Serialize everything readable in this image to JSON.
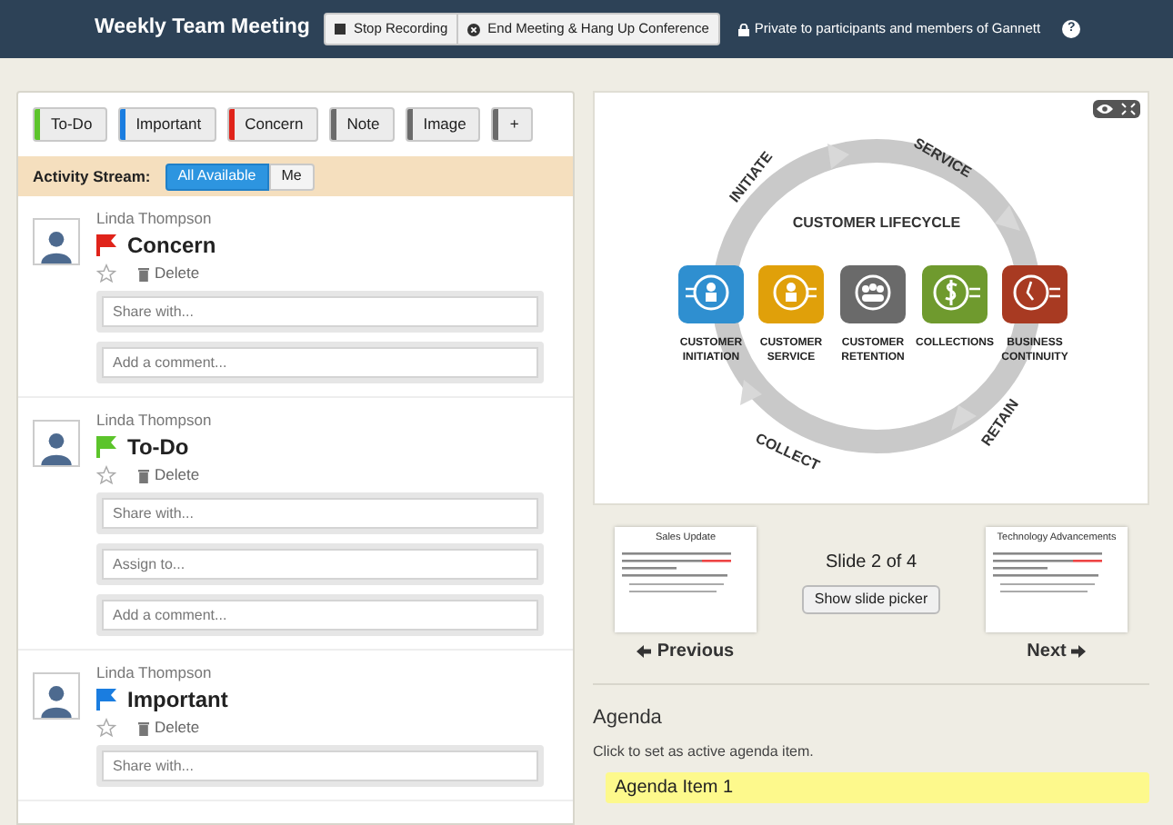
{
  "header": {
    "title": "Weekly Team Meeting",
    "buttons": [
      {
        "label": "Stop Recording",
        "kind": "stop"
      },
      {
        "label": "End Meeting & Hang Up Conference",
        "kind": "end"
      }
    ],
    "privacy": "Private to participants and members of Gannett",
    "help": "?"
  },
  "tags": [
    {
      "label": "To-Do",
      "color": "#5cc42b"
    },
    {
      "label": "Important",
      "color": "#1a7de0"
    },
    {
      "label": "Concern",
      "color": "#e0231a"
    },
    {
      "label": "Note",
      "color": "#6b6b6b"
    },
    {
      "label": "Image",
      "color": "#6b6b6b"
    },
    {
      "label": "+",
      "color": "#6b6b6b"
    }
  ],
  "activity_stream": {
    "label": "Activity Stream:",
    "filters": [
      {
        "label": "All Available",
        "selected": true
      },
      {
        "label": "Me",
        "selected": false
      }
    ]
  },
  "entries": [
    {
      "author": "Linda Thompson",
      "title": "Concern",
      "color": "#e0231a",
      "delete": "Delete",
      "fields": [
        {
          "placeholder": "Share with..."
        },
        {
          "placeholder": "Add a comment..."
        }
      ]
    },
    {
      "author": "Linda Thompson",
      "title": "To-Do",
      "color": "#5cc42b",
      "delete": "Delete",
      "fields": [
        {
          "placeholder": "Share with..."
        },
        {
          "placeholder": "Assign to..."
        },
        {
          "placeholder": "Add a comment..."
        }
      ]
    },
    {
      "author": "Linda Thompson",
      "title": "Important",
      "color": "#1a7de0",
      "delete": "Delete",
      "fields": [
        {
          "placeholder": "Share with..."
        }
      ]
    }
  ],
  "slide": {
    "title": "CUSTOMER LIFECYCLE",
    "ring_labels": [
      "INITIATE",
      "SERVICE",
      "RETAIN",
      "COLLECT"
    ],
    "stages": [
      {
        "lines": [
          "CUSTOMER",
          "INITIATION"
        ],
        "color": "#2f8fd0",
        "kind": "person-in"
      },
      {
        "lines": [
          "CUSTOMER",
          "SERVICE"
        ],
        "color": "#e0a00a",
        "kind": "person-out"
      },
      {
        "lines": [
          "CUSTOMER",
          "RETENTION"
        ],
        "color": "#6a6a6a",
        "kind": "group"
      },
      {
        "lines": [
          "COLLECTIONS"
        ],
        "color": "#6f9a2e",
        "kind": "dollar"
      },
      {
        "lines": [
          "BUSINESS",
          "CONTINUITY"
        ],
        "color": "#a83a22",
        "kind": "clock"
      }
    ]
  },
  "slide_nav": {
    "counter": "Slide 2 of 4",
    "picker": "Show slide picker",
    "previous": {
      "label": "Previous",
      "title": "Sales Update"
    },
    "next": {
      "label": "Next",
      "title": "Technology Advancements"
    }
  },
  "agenda": {
    "heading": "Agenda",
    "hint": "Click to set as active agenda item.",
    "items": [
      {
        "label": "Agenda Item 1"
      }
    ]
  }
}
